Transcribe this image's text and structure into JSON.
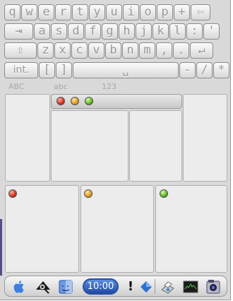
{
  "keyboard": {
    "row1": [
      "q",
      "w",
      "e",
      "r",
      "t",
      "y",
      "u",
      "i",
      "o",
      "p",
      "+"
    ],
    "row2": [
      "a",
      "s",
      "d",
      "f",
      "g",
      "h",
      "j",
      "k",
      "l",
      ":",
      "'"
    ],
    "row3": [
      "z",
      "x",
      "c",
      "v",
      "b",
      "n",
      "m",
      ",",
      "."
    ],
    "row4_int": "int.",
    "row4_brackets": [
      "[",
      "]"
    ],
    "row4_right": [
      "-",
      "/",
      "*"
    ],
    "backspace_glyph": "⇦",
    "tab_glyph": "⇥",
    "shift_glyph": "⇧",
    "enter_glyph": "↵",
    "space_glyph": "␣"
  },
  "modes": {
    "abc_upper": "ABC",
    "abc_lower": "abc",
    "numbers": "123"
  },
  "dock": {
    "clock": "10:00",
    "alert_glyph": "!"
  },
  "colors": {
    "key_text": "#9a9a9a",
    "clock_bg": "#1e4aa8",
    "red": "#d0301a",
    "yellow": "#e39a1a",
    "green": "#5db51a"
  },
  "icons": [
    "apple-icon",
    "search-eye-icon",
    "finder-icon",
    "clock-badge",
    "alert-icon",
    "diamond-icon",
    "printer-icon",
    "terminal-icon",
    "camera-icon"
  ]
}
